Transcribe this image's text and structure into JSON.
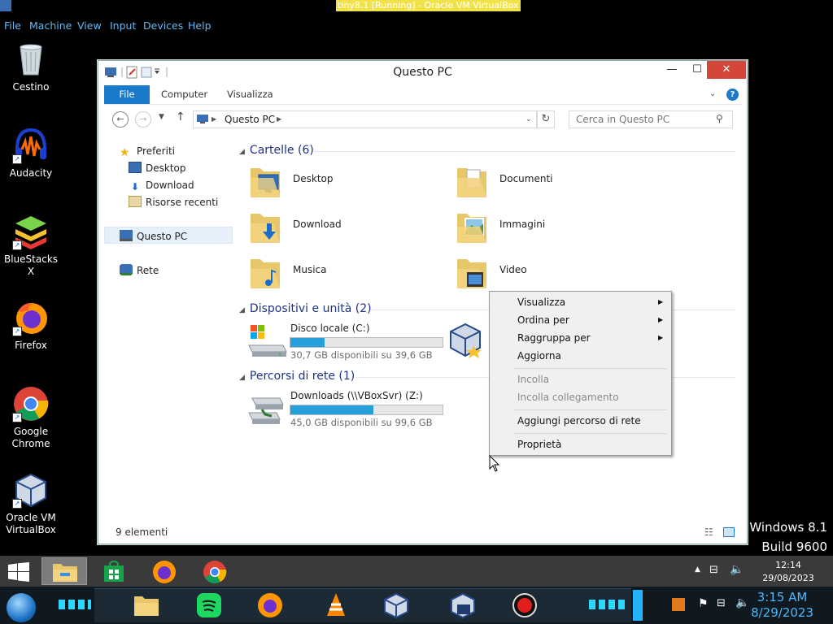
{
  "host": {
    "title": "tiny8.1 [Running] - Oracle VM VirtualBox",
    "menu": [
      "File",
      "Machine",
      "View",
      "Input",
      "Devices",
      "Help"
    ]
  },
  "desktop_icons": [
    {
      "label": "Cestino",
      "icon": "recycle-bin-icon"
    },
    {
      "label": "Audacity",
      "icon": "audacity-icon"
    },
    {
      "label": "BlueStacks X",
      "icon": "bluestacks-icon"
    },
    {
      "label": "Firefox",
      "icon": "firefox-icon"
    },
    {
      "label": "Google Chrome",
      "icon": "chrome-icon"
    },
    {
      "label": "Oracle VM VirtualBox",
      "icon": "virtualbox-icon"
    }
  ],
  "explorer": {
    "title": "Questo PC",
    "ribbon_tabs": [
      "File",
      "Computer",
      "Visualizza"
    ],
    "address": "Questo PC",
    "search_placeholder": "Cerca in Questo PC",
    "nav": {
      "favorites": "Preferiti",
      "fav_items": [
        "Desktop",
        "Download",
        "Risorse recenti"
      ],
      "this_pc": "Questo PC",
      "network": "Rete"
    },
    "sections": {
      "folders": "Cartelle (6)",
      "devices": "Dispositivi e unità (2)",
      "network": "Percorsi di rete (1)"
    },
    "folders": [
      "Desktop",
      "Documenti",
      "Download",
      "Immagini",
      "Musica",
      "Video"
    ],
    "drives": [
      {
        "name": "Disco locale (C:)",
        "free": "30,7 GB disponibili su 39,6 GB",
        "used_fraction": 0.225
      },
      {
        "name": "Downloads (\\\\VBoxSvr) (Z:)",
        "free": "45,0 GB disponibili su 99,6 GB",
        "used_fraction": 0.548
      }
    ],
    "status": "9 elementi"
  },
  "context_menu": {
    "items": [
      {
        "label": "Visualizza",
        "submenu": true,
        "disabled": false
      },
      {
        "label": "Ordina per",
        "submenu": true,
        "disabled": false
      },
      {
        "label": "Raggruppa per",
        "submenu": true,
        "disabled": false
      },
      {
        "label": "Aggiorna",
        "submenu": false,
        "disabled": false
      },
      {
        "label": "Incolla",
        "submenu": false,
        "disabled": true
      },
      {
        "label": "Incolla collegamento",
        "submenu": false,
        "disabled": true
      },
      {
        "label": "Aggiungi percorso di rete",
        "submenu": false,
        "disabled": false
      },
      {
        "label": "Proprietà",
        "submenu": false,
        "disabled": false
      }
    ]
  },
  "watermark": {
    "line1": "Windows 8.1",
    "line2": "Build 9600"
  },
  "taskbar": {
    "time": "12:14",
    "date": "29/08/2023"
  },
  "dock": {
    "time": "3:15 AM",
    "date": "8/29/2023"
  },
  "colors": {
    "accent": "#1979ca",
    "progress": "#26a0da",
    "close": "#d4453a",
    "heading": "#1e3287"
  }
}
